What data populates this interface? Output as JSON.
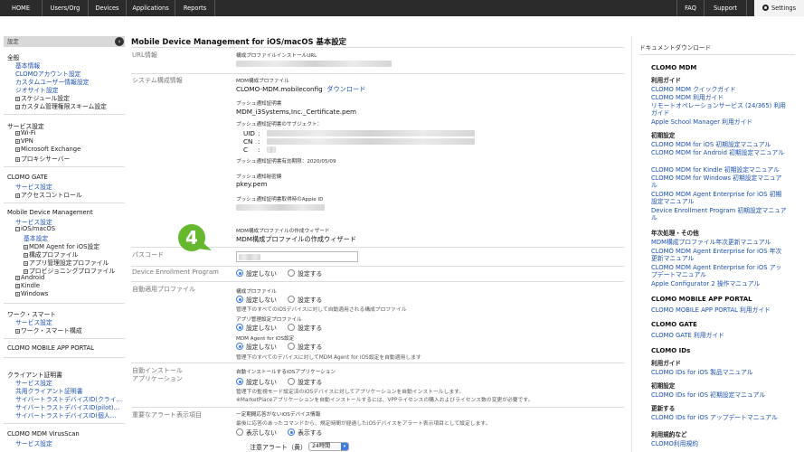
{
  "topnav": {
    "home": "HOME",
    "users_org": "Users/Org",
    "devices": "Devices",
    "applications": "Applications",
    "reports": "Reports",
    "faq": "FAQ",
    "support": "Support",
    "settings": "Settings"
  },
  "sidebar": {
    "header": "設定",
    "groups": {
      "general": "全般",
      "services": "サービス設定",
      "gate": "CLOMO GATE",
      "mdm": "Mobile Device Management",
      "work": "ワーク・スマート",
      "portal": "CLOMO MOBILE APP PORTAL",
      "client_cert": "クライアント証明書",
      "virusscan": "CLOMO MDM VirusScan"
    },
    "items": {
      "basic_info": "基本情報",
      "account_settings": "CLOMOアカウント設定",
      "custom_user_info": "カスタムユーザー情報設定",
      "signage": "ジオサイト設定",
      "schedule": "スケジュール設定",
      "custom_schema": "カスタム管理権限スキーム設定",
      "wifi": "Wi-Fi",
      "vpn": "VPN",
      "exchange": "Microsoft Exchange",
      "proxy": "プロキシサーバー",
      "gate_service": "サービス設定",
      "access_control": "アクセスコントロール",
      "mdm_service": "サービス設定",
      "ios_macos": "iOS/macOS",
      "basic_settings": "基本設定",
      "agent": "MDM Agent for iOS設定",
      "config_profile": "構成プロファイル",
      "app_profile": "アプリ管理設定プロファイル",
      "provisioning": "プロビジョニングプロファイル",
      "android": "Android",
      "kindle": "Kindle",
      "windows": "Windows",
      "work_service": "サービス設定",
      "work_config": "ワーク・スマート構成",
      "cert_service": "サービス設定",
      "shared_cert": "共用クライアント証明書",
      "cyber_trust_1": "サイバートラストデバイスID(クライ…",
      "cyber_trust_2": "サイバートラストデバイスID(pilot)…",
      "cyber_trust_3": "サイバートラストデバイスID(個人…",
      "virus_service": "サービス設定"
    }
  },
  "main": {
    "title": "Mobile Device Management for iOS/macOS 基本設定",
    "url_info": {
      "label": "URL情報",
      "caption": "構成プロファイルインストールURL"
    },
    "system_config": {
      "label": "システム構成情報",
      "mdm_profile_caption": "MDM構成プロファイル",
      "mdm_profile_file": "CLOMO-MDM.mobileconfig",
      "download": "ダウンロード",
      "push_cert_caption": "プッシュ通知証明書",
      "push_cert_file": "MDM_i3Systems,Inc._Certificate.pem",
      "push_subject_caption": "プッシュ通知証明書のサブジェクト：",
      "uid": "UID",
      "cn": "CN",
      "c": "C",
      "colon": ":",
      "push_expiry": "プッシュ通知証明書有効期限：2020/05/09",
      "push_key_caption": "プッシュ通知秘密鍵",
      "push_key_file": "pkey.pem",
      "apple_id_caption": "プッシュ通知証明書取得時のApple ID",
      "wizard_caption": "MDM構成プロファイルの作成ウィザード",
      "wizard_link": "MDM構成プロファイルの作成ウィザード"
    },
    "marker_number": "4",
    "passcode": {
      "label": "パスコード"
    },
    "dep": {
      "label": "Device Enrollment Program",
      "off": "設定しない",
      "on": "設定する"
    },
    "auto_profile": {
      "label": "自動適用プロファイル",
      "config_caption": "構成プロファイル",
      "off": "設定しない",
      "on": "設定する",
      "config_note": "管理下のすべてのiOSデバイスに対して自動適用される構成プロファイル",
      "app_caption": "アプリ管理設定プロファイル",
      "agent_caption": "MDM Agent for iOS設定",
      "agent_note": "管理下のすべてのデバイスに対してMDM Agent for iOS設定を自動適用します"
    },
    "auto_install": {
      "label": "自動インストール",
      "label2": "アプリケーション",
      "caption": "自動インストールするiOSアプリケーション",
      "off": "設定しない",
      "on": "設定する",
      "note1": "管理下の監視モード設定済のiOSデバイスに対してアプリケーションを自動インストールします。",
      "note2": "※MarketPlaceアプリケーションを自動インストールするには、VPPライセンスの購入およびライセンス数の変更が必要です。"
    },
    "alert": {
      "label": "重要なアラート表示項目",
      "caption": "一定期間応答がないiOSデバイス情報",
      "note": "最後に応答のあったコマンドから、規定時間が経過したiOSデバイスをアラート表示項目として設定します。",
      "off": "表示しない",
      "on": "表示する",
      "select_label": "注意アラート（黄）",
      "select_value": "24時間"
    }
  },
  "rightpanel": {
    "title": "ドキュメントダウンロード",
    "sections": {
      "mdm": "CLOMO MDM",
      "portal": "CLOMO MOBILE APP PORTAL",
      "gate": "CLOMO GATE",
      "ids": "CLOMO IDs"
    },
    "subs": {
      "usage_guide": "利用ガイド",
      "initial_setup": "初期設定",
      "annual": "年次処理・その他",
      "ids_usage": "利用ガイド",
      "ids_initial": "初期設定",
      "ids_update": "更新する",
      "terms": "利用規約など"
    },
    "links": {
      "quick_guide": "CLOMO MDM クイックガイド",
      "usage_guide": "CLOMO MDM 利用ガイド",
      "remote_ops": "リモートオペレーションサービス (24/365) 利用ガイド",
      "school_manager": "Apple School Manager 利用ガイド",
      "ios_init": "CLOMO MDM for iOS 初期設定マニュアル",
      "android_init": "CLOMO MDM for Android 初期設定マニュアル",
      "kindle_init": "CLOMO MDM for Kindle 初期設定マニュアル",
      "windows_init": "CLOMO MDM for Windows 初期設定マニュアル",
      "agent_enterprise": "CLOMO MDM Agent Enterprise for iOS 初期設定マニュアル",
      "dep_init": "Device Enrollment Program 初期設定マニュアル",
      "profile_renew": "MDM構成プロファイル年次更新マニュアル",
      "agent_annual": "CLOMO MDM Agent Enterprise for iOS 年次更新マニュアル",
      "agent_update": "CLOMO MDM Agent Enterprise for iOS アップデートマニュアル",
      "configurator": "Apple Configurator 2 操作マニュアル",
      "portal_guide": "CLOMO MOBILE APP PORTAL 利用ガイド",
      "gate_guide": "CLOMO GATE 利用ガイド",
      "ids_product": "CLOMO IDs for iOS 製品マニュアル",
      "ids_init": "CLOMO IDs for iOS 初期設定マニュアル",
      "ids_update": "CLOMO IDs for iOS アップデートマニュアル",
      "terms": "CLOMO利用規約"
    }
  },
  "colors": {
    "nav_bg": "#2b2b2b",
    "link": "#1a4fb4",
    "marker": "#66b82e",
    "radio_accent": "#3c7be6"
  }
}
